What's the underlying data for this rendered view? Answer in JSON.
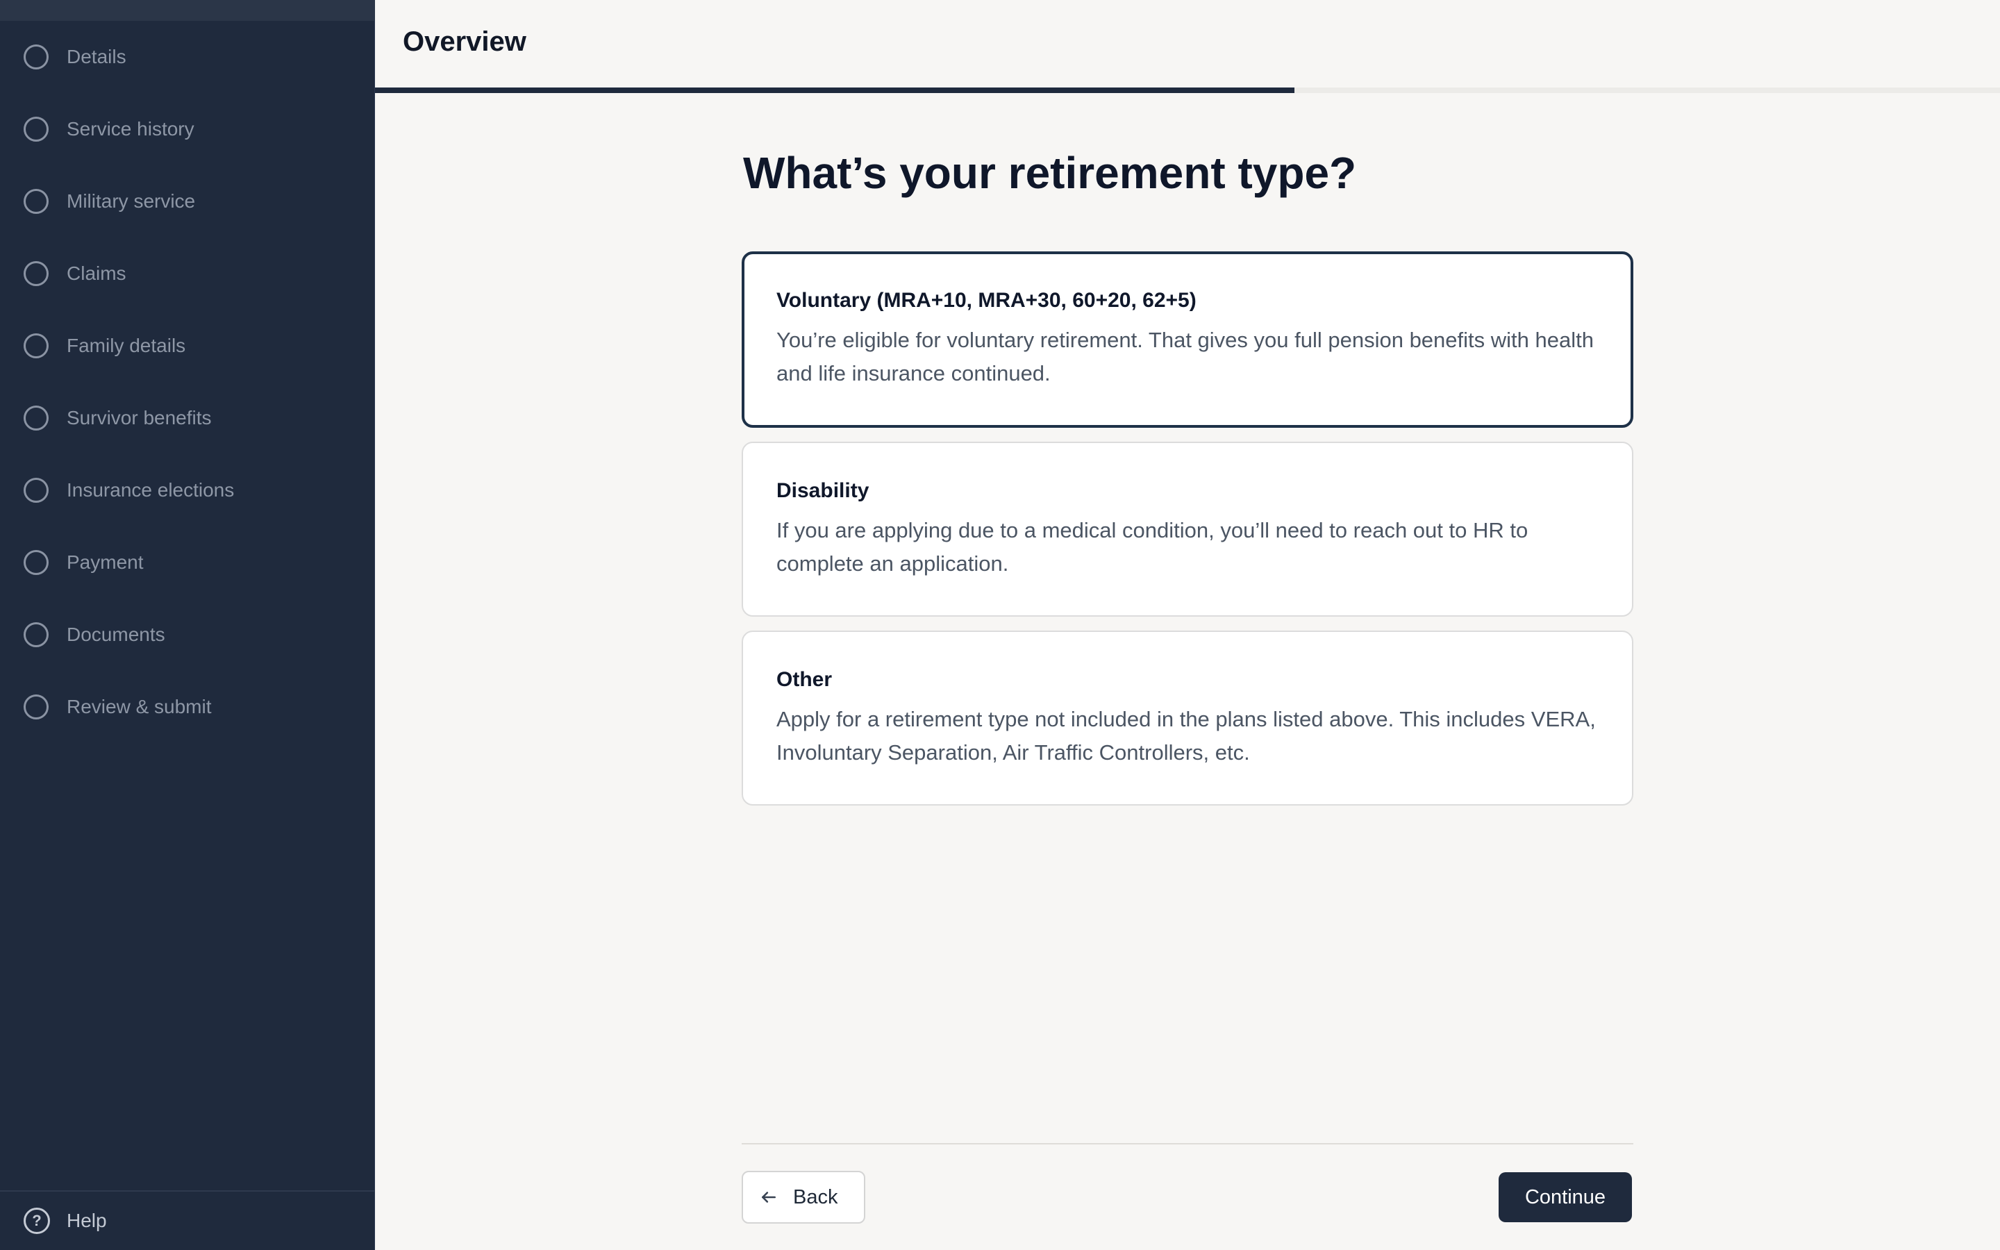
{
  "sidebar": {
    "items": [
      {
        "label": "Details"
      },
      {
        "label": "Service history"
      },
      {
        "label": "Military service"
      },
      {
        "label": "Claims"
      },
      {
        "label": "Family details"
      },
      {
        "label": "Survivor benefits"
      },
      {
        "label": "Insurance elections"
      },
      {
        "label": "Payment"
      },
      {
        "label": "Documents"
      },
      {
        "label": "Review & submit"
      }
    ],
    "help_label": "Help"
  },
  "header": {
    "title": "Overview",
    "progress_fraction": 0.566
  },
  "main": {
    "question": "What’s your retirement type?",
    "options": [
      {
        "title": "Voluntary (MRA+10, MRA+30, 60+20, 62+5)",
        "description": "You’re eligible for voluntary retirement. That gives you full pension benefits with health and life insurance continued.",
        "selected": true
      },
      {
        "title": "Disability",
        "description": "If you are applying due to a medical condition, you’ll need to reach out to HR to complete an application.",
        "selected": false
      },
      {
        "title": "Other",
        "description": "Apply for a retirement type not included in the plans listed above. This includes VERA, Involuntary Separation, Air Traffic Controllers, etc.",
        "selected": false
      }
    ]
  },
  "footer": {
    "back_label": "Back",
    "continue_label": "Continue"
  },
  "colors": {
    "sidebar_bg": "#1f2a3d",
    "accent": "#1e3148",
    "page_bg": "#f7f6f4"
  }
}
